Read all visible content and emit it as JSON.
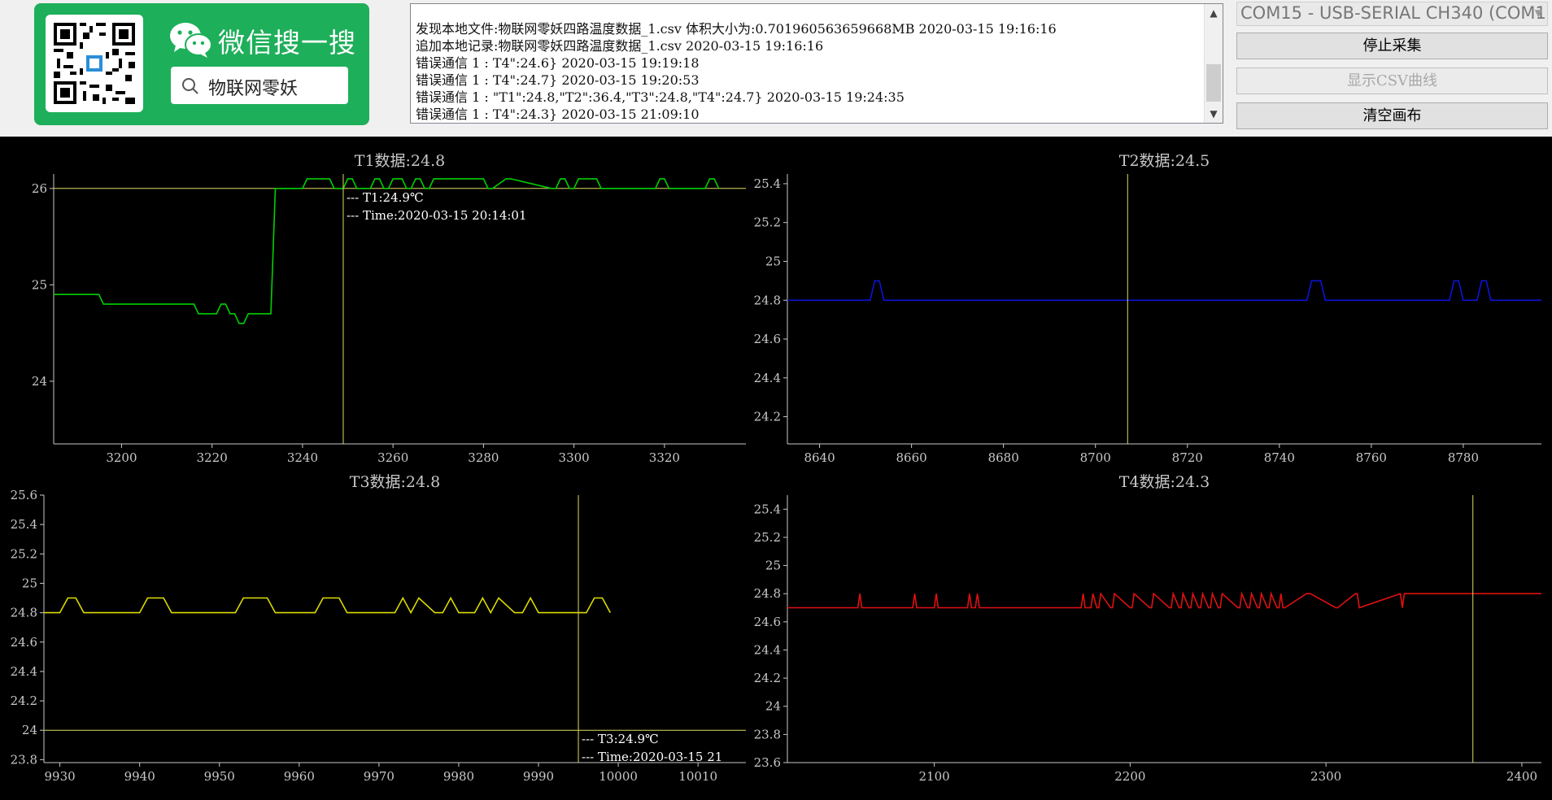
{
  "branding": {
    "search_title": "微信搜一搜",
    "search_query": "物联网零妖"
  },
  "log": {
    "lines": [
      "发现本地文件:物联网零妖四路温度数据_1.csv 体积大小为:0.701960563659668MB  2020-03-15 19:16:16",
      "追加本地记录:物联网零妖四路温度数据_1.csv  2020-03-15 19:16:16",
      "错误通信 1 : T4\":24.6}  2020-03-15 19:19:18",
      "错误通信 1 : T4\":24.7}  2020-03-15 19:20:53",
      "错误通信 1 : \"T1\":24.8,\"T2\":36.4,\"T3\":24.8,\"T4\":24.7}  2020-03-15 19:24:35",
      "错误通信 1 : T4\":24.3}  2020-03-15 21:09:10"
    ]
  },
  "controls": {
    "port": "COM15 - USB-SERIAL CH340 (COM1",
    "stop_label": "停止采集",
    "show_csv_label": "显示CSV曲线",
    "clear_label": "清空画布"
  },
  "colors": {
    "axis": "#c8c8c8",
    "T1": "#00d000",
    "T2": "#0a14d8",
    "T3": "#dcdc00",
    "T4": "#e01010",
    "crosshair": "#dcdc64",
    "wechat": "#1eaf5a"
  },
  "chart_data": [
    {
      "type": "line",
      "title": "T1数据:24.8",
      "xlim": [
        3185,
        3338
      ],
      "ylim": [
        23.35,
        26.15
      ],
      "xticks": [
        3200,
        3220,
        3240,
        3260,
        3280,
        3300,
        3320
      ],
      "yticks": [
        24,
        25,
        26
      ],
      "hline": 26,
      "vline": 3249,
      "annotation": [
        "--- T1:24.9℃",
        "--- Time:2020-03-15 20:14:01"
      ],
      "series": [
        {
          "x": [
            3185,
            3195,
            3196,
            3216,
            3217,
            3221,
            3222,
            3223,
            3224,
            3225,
            3226,
            3227,
            3228,
            3229,
            3230,
            3233,
            3234,
            3240,
            3241,
            3246,
            3247,
            3249,
            3250,
            3251,
            3252,
            3255,
            3256,
            3257,
            3258,
            3259,
            3260,
            3262,
            3263,
            3264,
            3265,
            3266,
            3267,
            3268,
            3269,
            3275,
            3276,
            3280,
            3281,
            3282,
            3285,
            3286,
            3295,
            3296,
            3297,
            3298,
            3299,
            3300,
            3301,
            3302,
            3303,
            3305,
            3306,
            3318,
            3319,
            3320,
            3321,
            3329,
            3330,
            3331,
            3332
          ],
          "y": [
            24.9,
            24.9,
            24.8,
            24.8,
            24.7,
            24.7,
            24.8,
            24.8,
            24.7,
            24.7,
            24.6,
            24.6,
            24.7,
            24.7,
            24.7,
            24.7,
            26.0,
            26.0,
            26.1,
            26.1,
            26.0,
            26.0,
            26.1,
            26.1,
            26.0,
            26.0,
            26.1,
            26.1,
            26.0,
            26.0,
            26.1,
            26.1,
            26.0,
            26.0,
            26.1,
            26.1,
            26.0,
            26.0,
            26.1,
            26.1,
            26.1,
            26.1,
            26.0,
            26.0,
            26.1,
            26.1,
            26.0,
            26.0,
            26.1,
            26.1,
            26.0,
            26.0,
            26.1,
            26.1,
            26.1,
            26.1,
            26.0,
            26.0,
            26.1,
            26.1,
            26.0,
            26.0,
            26.1,
            26.1,
            26.0
          ]
        }
      ]
    },
    {
      "type": "line",
      "title": "T2数据:24.5",
      "xlim": [
        8633,
        8797
      ],
      "ylim": [
        24.06,
        25.45
      ],
      "xticks": [
        8640,
        8660,
        8680,
        8700,
        8720,
        8740,
        8760,
        8780
      ],
      "yticks": [
        24.2,
        24.4,
        24.6,
        24.8,
        25,
        25.2,
        25.4
      ],
      "ytick_labels": [
        "24.2",
        "24.4",
        "24.6",
        "24.8",
        "25",
        "25.2",
        "25.4"
      ],
      "vline": 8707,
      "series": [
        {
          "x": [
            8633,
            8651,
            8652,
            8653,
            8654,
            8746,
            8747,
            8749,
            8750,
            8777,
            8778,
            8779,
            8780,
            8783,
            8784,
            8785,
            8786,
            8797
          ],
          "y": [
            24.8,
            24.8,
            24.9,
            24.9,
            24.8,
            24.8,
            24.9,
            24.9,
            24.8,
            24.8,
            24.9,
            24.9,
            24.8,
            24.8,
            24.9,
            24.9,
            24.8,
            24.8
          ]
        }
      ]
    },
    {
      "type": "line",
      "title": "T3数据:24.8",
      "xlim": [
        9928,
        10016
      ],
      "ylim": [
        23.78,
        25.6
      ],
      "xticks": [
        9930,
        9940,
        9950,
        9960,
        9970,
        9980,
        9990,
        10000,
        10010
      ],
      "yticks": [
        23.8,
        24,
        24.2,
        24.4,
        24.6,
        24.8,
        25,
        25.2,
        25.4,
        25.6
      ],
      "ytick_labels": [
        "23.8",
        "24",
        "24.2",
        "24.4",
        "24.6",
        "24.8",
        "25",
        "25.2",
        "25.4",
        "25.6"
      ],
      "hline": 24,
      "vline": 9995,
      "annotation": [
        "--- T3:24.9℃",
        "--- Time:2020-03-15 21"
      ],
      "series": [
        {
          "x": [
            9928,
            9930,
            9931,
            9932,
            9933,
            9940,
            9941,
            9943,
            9944,
            9952,
            9953,
            9956,
            9957,
            9962,
            9963,
            9965,
            9966,
            9972,
            9973,
            9974,
            9975,
            9977,
            9978,
            9979,
            9980,
            9982,
            9983,
            9984,
            9985,
            9987,
            9988,
            9989,
            9990,
            9996,
            9997,
            9998,
            9999
          ],
          "y": [
            24.8,
            24.8,
            24.9,
            24.9,
            24.8,
            24.8,
            24.9,
            24.9,
            24.8,
            24.8,
            24.9,
            24.9,
            24.8,
            24.8,
            24.9,
            24.9,
            24.8,
            24.8,
            24.9,
            24.8,
            24.9,
            24.8,
            24.8,
            24.9,
            24.8,
            24.8,
            24.9,
            24.8,
            24.9,
            24.8,
            24.8,
            24.9,
            24.8,
            24.8,
            24.9,
            24.9,
            24.8
          ]
        }
      ]
    },
    {
      "type": "line",
      "title": "T4数据:24.3",
      "xlim": [
        2025,
        2410
      ],
      "ylim": [
        23.6,
        25.5
      ],
      "xticks": [
        2100,
        2200,
        2300,
        2400
      ],
      "yticks": [
        23.6,
        23.8,
        24,
        24.2,
        24.4,
        24.6,
        24.8,
        25,
        25.2,
        25.4
      ],
      "ytick_labels": [
        "23.6",
        "23.8",
        "24",
        "24.2",
        "24.4",
        "24.6",
        "24.8",
        "25",
        "25.2",
        "25.4"
      ],
      "vline": 2375,
      "series": [
        {
          "x": [
            2025,
            2061,
            2062,
            2063,
            2089,
            2090,
            2091,
            2100,
            2101,
            2102,
            2117,
            2118,
            2119,
            2121,
            2122,
            2123,
            2175,
            2176,
            2177,
            2180,
            2181,
            2183,
            2184,
            2185,
            2190,
            2191,
            2192,
            2200,
            2201,
            2202,
            2210,
            2211,
            2212,
            2220,
            2221,
            2222,
            2225,
            2226,
            2227,
            2230,
            2231,
            2232,
            2235,
            2236,
            2237,
            2240,
            2241,
            2242,
            2245,
            2246,
            2247,
            2255,
            2256,
            2257,
            2260,
            2261,
            2262,
            2265,
            2266,
            2267,
            2270,
            2271,
            2272,
            2275,
            2276,
            2277,
            2278,
            2279,
            2290,
            2291,
            2292,
            2305,
            2306,
            2315,
            2316,
            2317,
            2338,
            2339,
            2340,
            2410
          ],
          "y": [
            24.7,
            24.7,
            24.8,
            24.7,
            24.7,
            24.8,
            24.7,
            24.7,
            24.8,
            24.7,
            24.7,
            24.8,
            24.7,
            24.7,
            24.8,
            24.7,
            24.7,
            24.8,
            24.7,
            24.7,
            24.8,
            24.7,
            24.7,
            24.8,
            24.7,
            24.7,
            24.8,
            24.7,
            24.7,
            24.8,
            24.7,
            24.7,
            24.8,
            24.7,
            24.7,
            24.8,
            24.7,
            24.7,
            24.8,
            24.7,
            24.7,
            24.8,
            24.7,
            24.7,
            24.8,
            24.7,
            24.7,
            24.8,
            24.7,
            24.7,
            24.8,
            24.7,
            24.7,
            24.8,
            24.7,
            24.7,
            24.8,
            24.7,
            24.7,
            24.8,
            24.7,
            24.7,
            24.8,
            24.7,
            24.7,
            24.8,
            24.7,
            24.7,
            24.8,
            24.8,
            24.8,
            24.7,
            24.7,
            24.8,
            24.8,
            24.7,
            24.8,
            24.7,
            24.8,
            24.8
          ]
        }
      ]
    }
  ]
}
